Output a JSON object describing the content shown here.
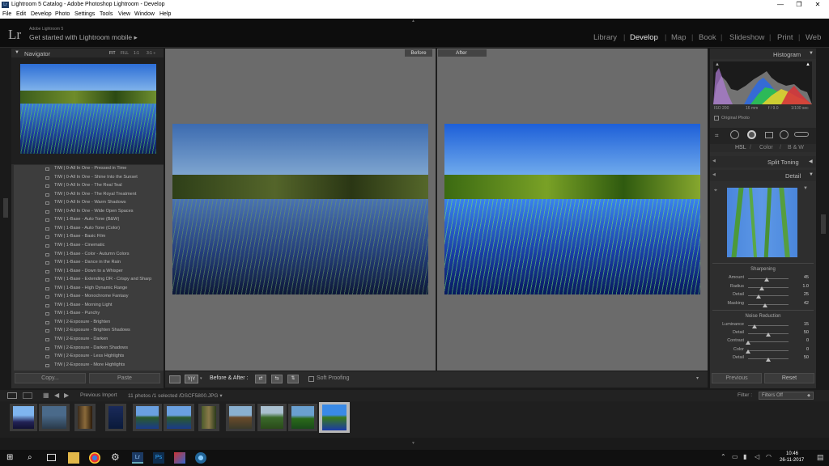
{
  "window": {
    "title": "Lightroom 5 Catalog - Adobe Photoshop Lightroom - Develop",
    "controls": [
      "—",
      "❐",
      "✕"
    ]
  },
  "menu": [
    "File",
    "Edit",
    "Develop",
    "Photo",
    "Settings",
    "Tools",
    "View",
    "Window",
    "Help"
  ],
  "identity": {
    "logo": "Lr",
    "product": "Adobe Lightroom 5",
    "prompt": "Get started with Lightroom mobile ▸"
  },
  "modules": [
    {
      "label": "Library",
      "active": false
    },
    {
      "label": "Develop",
      "active": true
    },
    {
      "label": "Map",
      "active": false
    },
    {
      "label": "Book",
      "active": false
    },
    {
      "label": "Slideshow",
      "active": false
    },
    {
      "label": "Print",
      "active": false
    },
    {
      "label": "Web",
      "active": false
    }
  ],
  "navigator": {
    "title": "Navigator",
    "zoom_options": [
      "FIT",
      "FILL",
      "1:1",
      "3:1 ÷"
    ]
  },
  "presets": [
    "TtW | 0-All In One - Pressed in Time",
    "TtW | 0-All In One - Shine Into the Sunset",
    "TtW | 0-All In One - The Real Teal",
    "TtW | 0-All In One - The Royal Treatment",
    "TtW | 0-All In One - Warm Shadows",
    "TtW | 0-All In One - Wide Open Spaces",
    "TtW | 1-Base - Auto Tone (B&W)",
    "TtW | 1-Base - Auto Tone (Color)",
    "TtW | 1-Base - Basic Film",
    "TtW | 1-Base - Cinematic",
    "TtW | 1-Base - Color - Autumn Colors",
    "TtW | 1-Base - Dance in the Rain",
    "TtW | 1-Base - Down to a Whisper",
    "TtW | 1-Base - Extending DR - Crispy and Sharp",
    "TtW | 1-Base - High Dynamic Range",
    "TtW | 1-Base - Monochrome Fantasy",
    "TtW | 1-Base - Morning Light",
    "TtW | 1-Base - Punchy",
    "TtW | 2-Exposure - Brighten",
    "TtW | 2-Exposure - Brighten Shadows",
    "TtW | 2-Exposure - Darken",
    "TtW | 2-Exposure - Darken Shadows",
    "TtW | 2-Exposure - Less Highlights",
    "TtW | 2-Exposure - More Highlights"
  ],
  "left_buttons": {
    "copy": "Copy...",
    "paste": "Paste"
  },
  "compare": {
    "before": "Before",
    "after": "After"
  },
  "toolbar": {
    "mode": "Y|Y",
    "before_after_label": "Before & After :",
    "soft_proofing": "Soft Proofing"
  },
  "histogram": {
    "title": "Histogram",
    "iso": "ISO 200",
    "focal": "16 mm",
    "aperture": "f / 9.0",
    "shutter": "1/100 sec",
    "original_photo": "Original Photo"
  },
  "right_sections": {
    "hsl": [
      "HSL",
      "/",
      "Color",
      "/",
      "B & W"
    ],
    "split_toning": "Split Toning",
    "detail": "Detail"
  },
  "sharpening": {
    "title": "Sharpening",
    "sliders": [
      {
        "label": "Amount",
        "value": "45",
        "level": 0.45
      },
      {
        "label": "Radius",
        "value": "1.0",
        "level": 0.33
      },
      {
        "label": "Detail",
        "value": "25",
        "level": 0.25
      },
      {
        "label": "Masking",
        "value": "42",
        "level": 0.42
      }
    ]
  },
  "noise_reduction": {
    "title": "Noise Reduction",
    "sliders": [
      {
        "label": "Luminance",
        "value": "15",
        "level": 0.15
      },
      {
        "label": "Detail",
        "value": "50",
        "level": 0.5
      },
      {
        "label": "Contrast",
        "value": "0",
        "level": 0.0
      },
      {
        "label": "Color",
        "value": "0",
        "level": 0.0
      },
      {
        "label": "Detail",
        "value": "50",
        "level": 0.5
      }
    ]
  },
  "right_buttons": {
    "previous": "Previous",
    "reset": "Reset"
  },
  "filmstrip_bar": {
    "source": "Previous Import",
    "count": "11 photos /1 selected /DSCF5800.JPG ▾",
    "filter_label": "Filter :",
    "filter_value": "Filters Off"
  },
  "taskbar": {
    "time": "10:46",
    "date": "26-11-2017"
  },
  "colors": {
    "panel": "#2e2e2e",
    "canvas": "#6b6b6b",
    "identity": "#0d0d0d",
    "filmstrip": "#1f1f1f"
  }
}
